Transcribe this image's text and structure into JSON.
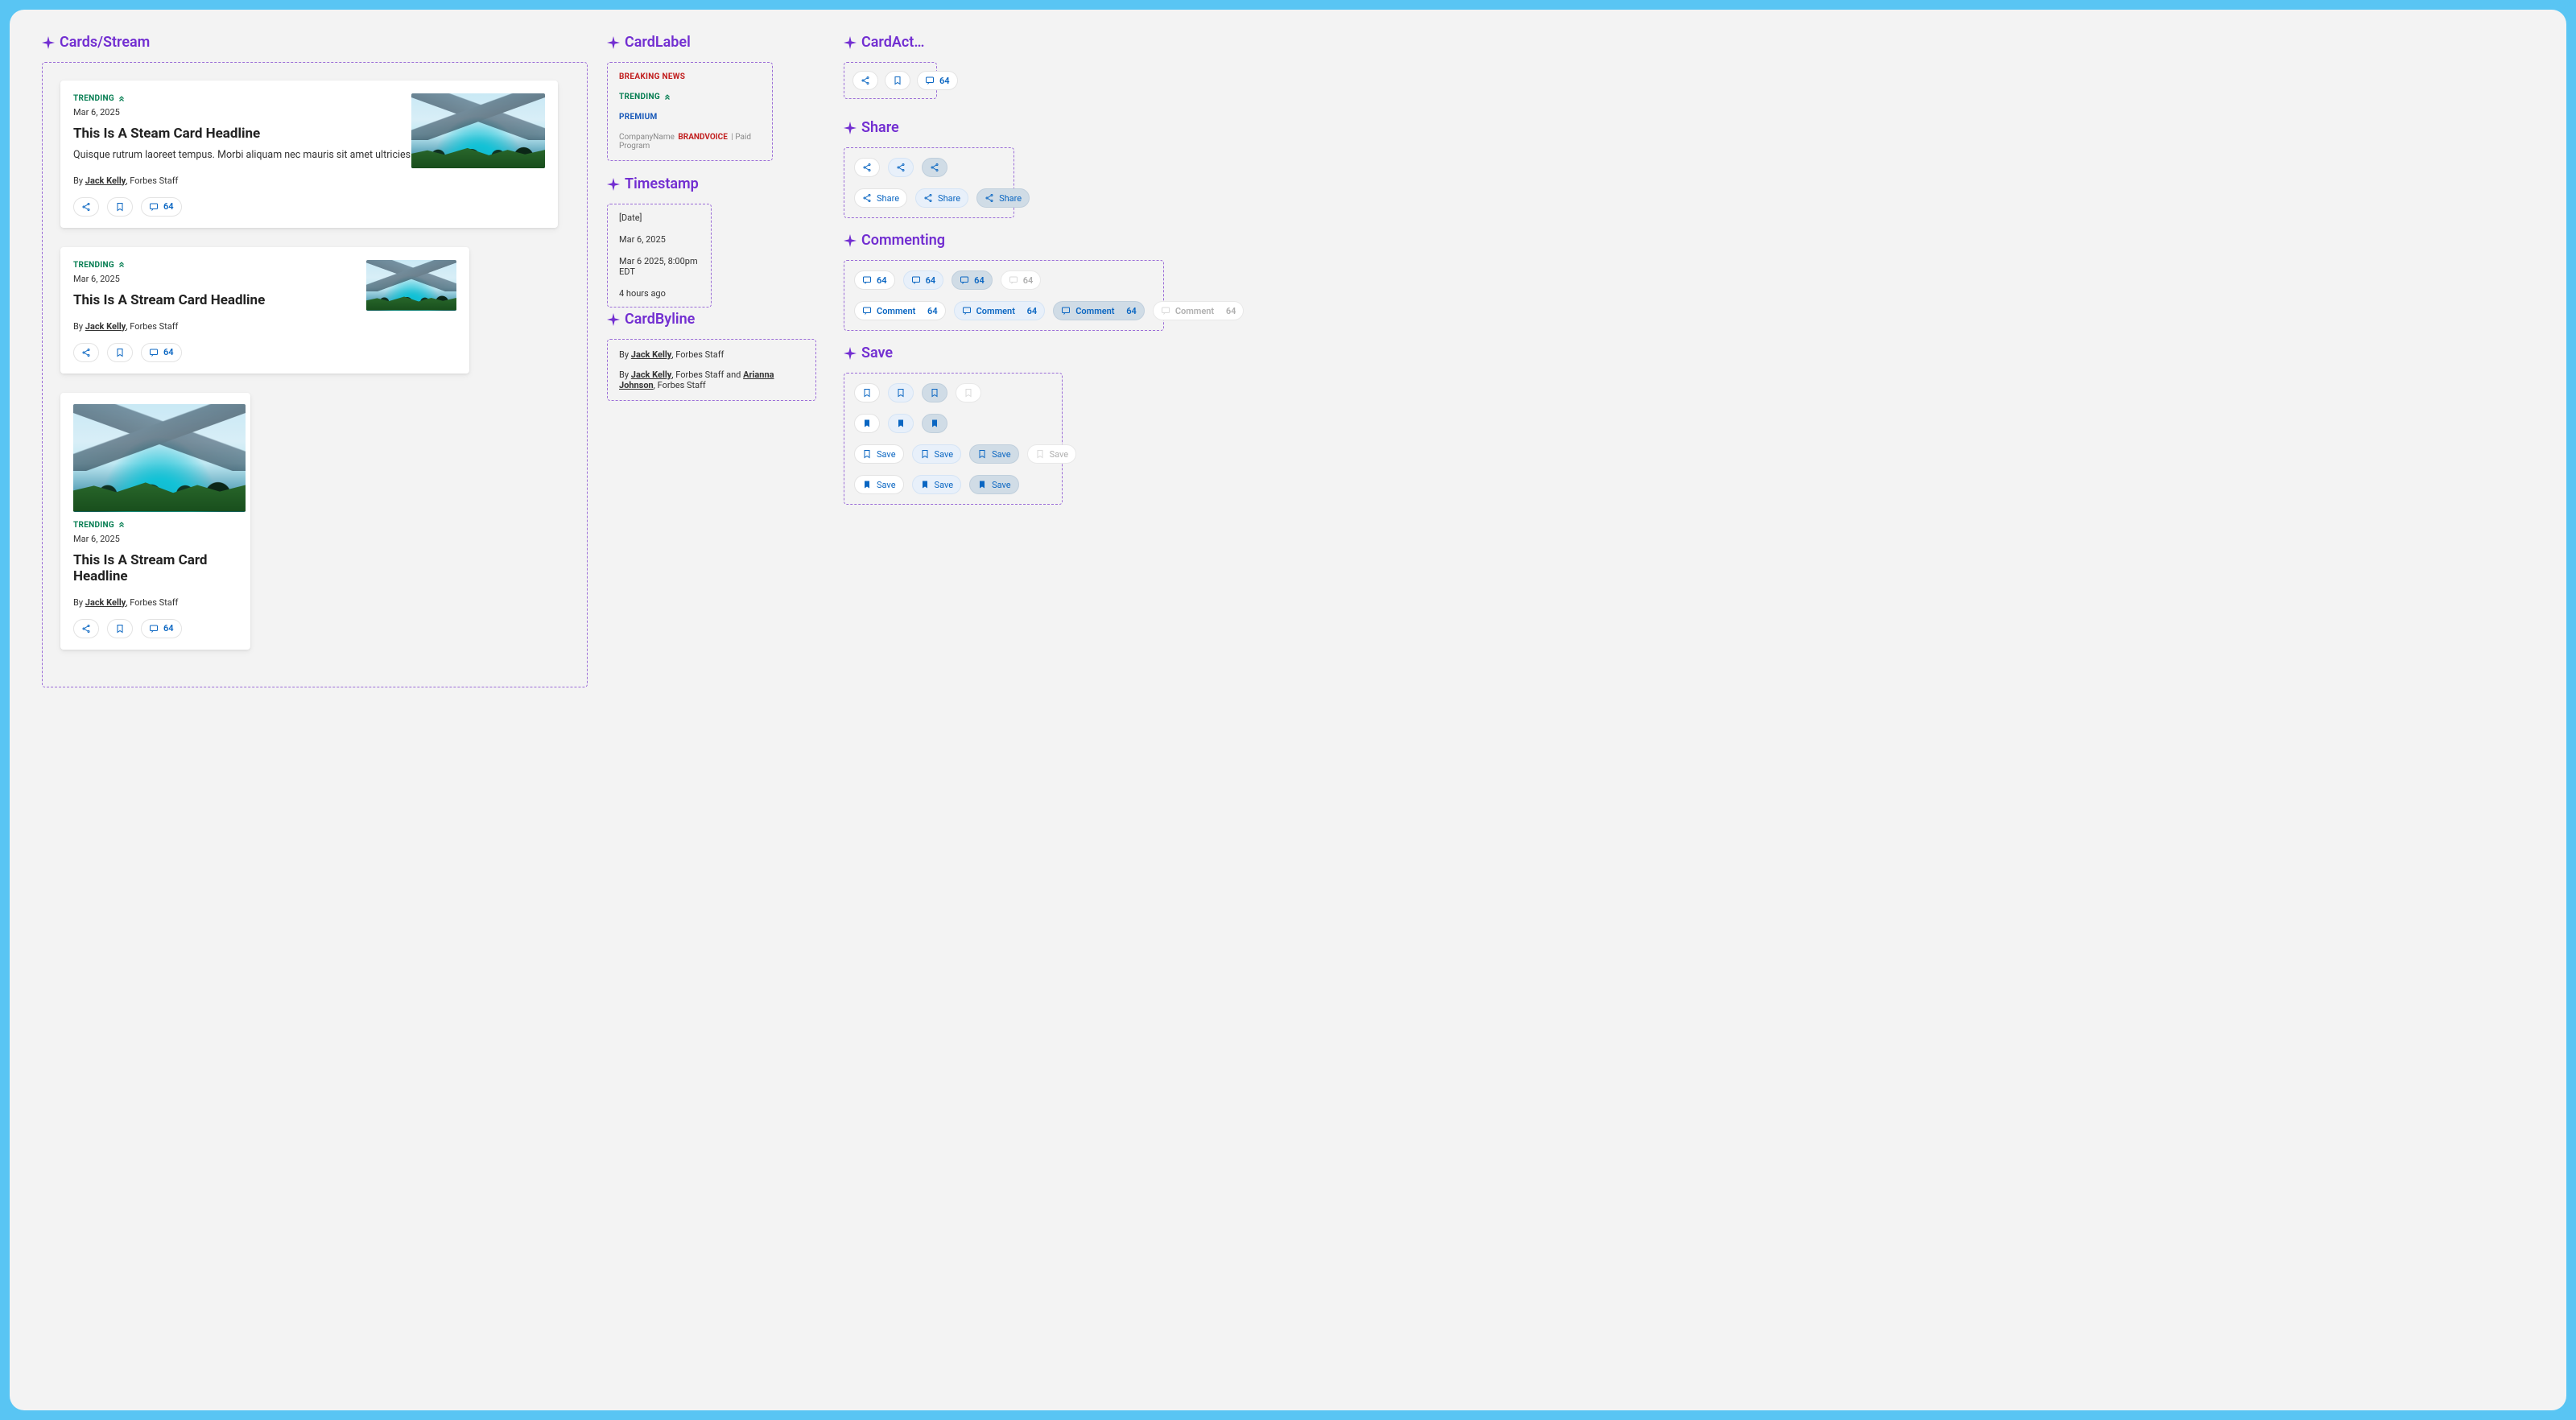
{
  "sections": {
    "streams": "Cards/Stream",
    "cardlabel": "CardLabel",
    "timestamp": "Timestamp",
    "cardbyline": "CardByline",
    "cardactions": "CardActions",
    "share": "Share",
    "commenting": "Commenting",
    "save": "Save"
  },
  "trending_label": "TRENDING",
  "cards": [
    {
      "date": "Mar 6, 2025",
      "headline": "This Is A Steam Card Headline",
      "desc": "Quisque rutrum laoreet tempus. Morbi aliquam nec mauris sit amet ultricies.",
      "by_prefix": "By ",
      "author": "Jack Kelly",
      "role": ", Forbes Staff",
      "comment_count": "64"
    },
    {
      "date": "Mar 6, 2025",
      "headline": "This Is A Stream Card Headline",
      "by_prefix": "By ",
      "author": "Jack Kelly",
      "role": ", Forbes Staff",
      "comment_count": "64"
    },
    {
      "date": "Mar 6, 2025",
      "headline": "This Is A Stream Card Headline",
      "by_prefix": "By ",
      "author": "Jack Kelly",
      "role": ", Forbes Staff",
      "comment_count": "64"
    }
  ],
  "labels": {
    "breaking": "BREAKING NEWS",
    "trending": "TRENDING",
    "premium": "PREMIUM",
    "brandvoice_company": "CompanyName",
    "brandvoice_label": "BRANDVOICE",
    "brandvoice_paid": "| Paid Program"
  },
  "timestamps": {
    "placeholder": "[Date]",
    "short": "Mar 6, 2025",
    "long": "Mar 6 2025, 8:00pm EDT",
    "relative": "4 hours ago"
  },
  "bylines": {
    "single_prefix": "By ",
    "single_author": "Jack Kelly",
    "single_role": ", Forbes Staff",
    "multi_prefix": "By ",
    "multi_a1": "Jack Kelly",
    "multi_r1": ", Forbes Staff",
    "multi_and": " and ",
    "multi_a2": "Arianna Johnson",
    "multi_r2": ", Forbes Staff"
  },
  "cardactions_count": "64",
  "share_label": "Share",
  "comment_label": "Comment",
  "comment_count": "64",
  "save_label": "Save"
}
